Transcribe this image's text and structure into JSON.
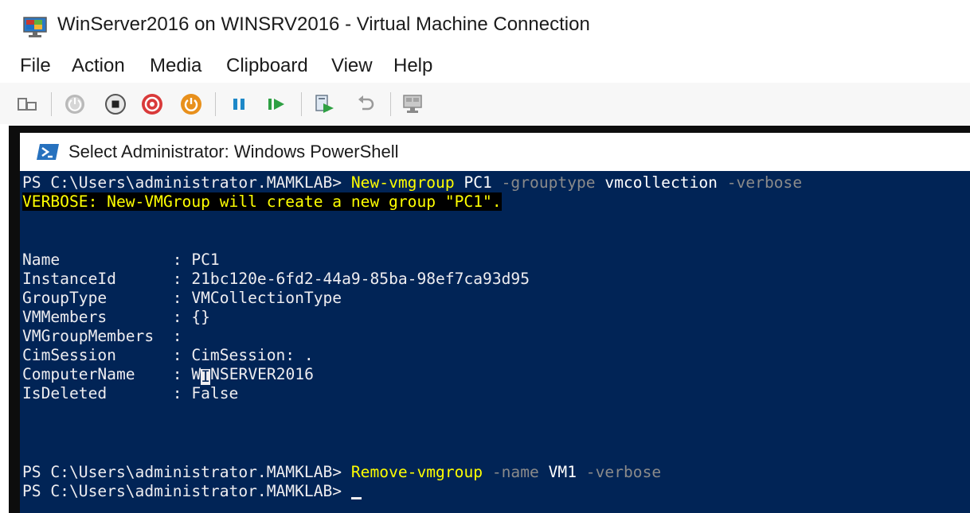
{
  "window": {
    "title": "WinServer2016 on WINSRV2016 - Virtual Machine Connection"
  },
  "menu": {
    "items": [
      {
        "label": "File"
      },
      {
        "label": "Action"
      },
      {
        "label": "Media"
      },
      {
        "label": "Clipboard"
      },
      {
        "label": "View"
      },
      {
        "label": "Help"
      }
    ]
  },
  "toolbar": {
    "icons": [
      "ctrl-alt-del-icon",
      "start-icon",
      "turn-off-icon",
      "shut-down-icon",
      "save-icon",
      "pause-icon",
      "resume-icon",
      "checkpoint-icon",
      "revert-icon",
      "enhanced-session-icon"
    ],
    "colors": {
      "shut_down": "#d93a3a",
      "save": "#e8901c",
      "pause": "#1e88c8",
      "resume": "#2ea043"
    }
  },
  "powershell": {
    "title": "Select Administrator: Windows PowerShell",
    "background": "#012456",
    "lines": {
      "cmd1_prompt": "PS C:\\Users\\administrator.MAMKLAB> ",
      "cmd1_cmdlet": "New-vmgroup",
      "cmd1_arg1": " PC1 ",
      "cmd1_param1": "-grouptype",
      "cmd1_arg2": " vmcollection ",
      "cmd1_param2": "-verbose",
      "verbose": "VERBOSE: New-VMGroup will create a new group \"PC1\".",
      "props": [
        {
          "name": "Name            ",
          "sep": ": ",
          "value": "PC1"
        },
        {
          "name": "InstanceId      ",
          "sep": ": ",
          "value": "21bc120e-6fd2-44a9-85ba-98ef7ca93d95"
        },
        {
          "name": "GroupType       ",
          "sep": ": ",
          "value": "VMCollectionType"
        },
        {
          "name": "VMMembers       ",
          "sep": ": ",
          "value": "{}"
        },
        {
          "name": "VMGroupMembers  ",
          "sep": ":",
          "value": ""
        },
        {
          "name": "CimSession      ",
          "sep": ": ",
          "value": "CimSession: ."
        },
        {
          "name": "ComputerName    ",
          "sep": ": ",
          "value_pre": "W",
          "value_cursor": "I",
          "value": "NSERVER2016"
        },
        {
          "name": "IsDeleted       ",
          "sep": ": ",
          "value": "False"
        }
      ],
      "cmd2_prompt": "PS C:\\Users\\administrator.MAMKLAB> ",
      "cmd2_cmdlet": "Remove-vmgroup",
      "cmd2_param1": " -name ",
      "cmd2_arg1": "VM1",
      "cmd2_param2": " -verbose",
      "cmd3_prompt": "PS C:\\Users\\administrator.MAMKLAB> "
    }
  }
}
